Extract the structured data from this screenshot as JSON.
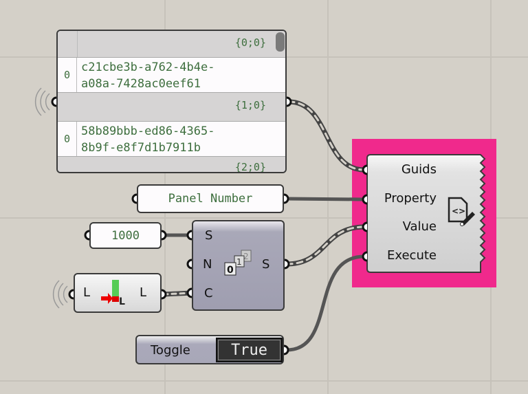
{
  "guid_panel": {
    "branches": [
      {
        "path": "{0;0}",
        "index": "0",
        "value_line1": "c21cbe3b-a762-4b4e-",
        "value_line2": "a08a-7428ac0eef61"
      },
      {
        "path": "{1;0}",
        "index": "0",
        "value_line1": "58b89bbb-ed86-4365-",
        "value_line2": "8b9f-e8f7d1b7911b"
      },
      {
        "path": "{2;0}"
      }
    ]
  },
  "property_panel": {
    "text": "Panel Number"
  },
  "start_panel": {
    "text": "1000"
  },
  "series": {
    "inputs": [
      "S",
      "N",
      "C"
    ],
    "output": "S",
    "icon": "series-icon"
  },
  "list_length": {
    "input": "L",
    "output": "L",
    "icon": "list-length-icon"
  },
  "toggle": {
    "label": "Toggle",
    "value": "True"
  },
  "set_property": {
    "inputs": [
      "Guids",
      "Property",
      "Value",
      "Execute"
    ],
    "icon": "edit-code-icon",
    "highlight_color": "#f0298c"
  }
}
